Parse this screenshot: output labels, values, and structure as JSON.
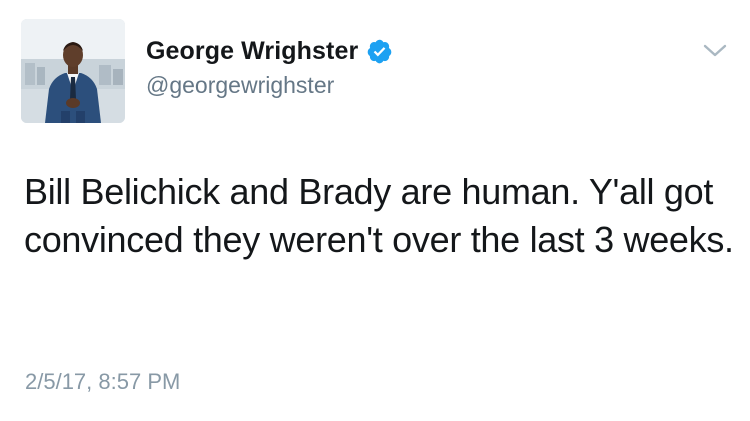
{
  "tweet": {
    "display_name": "George Wrighster",
    "handle": "@georgewrighster",
    "verified": true,
    "text": "Bill Belichick and Brady are human. Y'all got convinced they weren't over the last 3 weeks.",
    "timestamp": "2/5/17, 8:57 PM"
  },
  "icons": {
    "avatar": "profile-photo",
    "verified": "verified-badge-icon",
    "menu": "chevron-down-icon"
  },
  "colors": {
    "name": "#14171a",
    "handle": "#657786",
    "timestamp": "#8899a6",
    "verified_badge": "#1da1f2",
    "chevron": "#aab8c2"
  }
}
